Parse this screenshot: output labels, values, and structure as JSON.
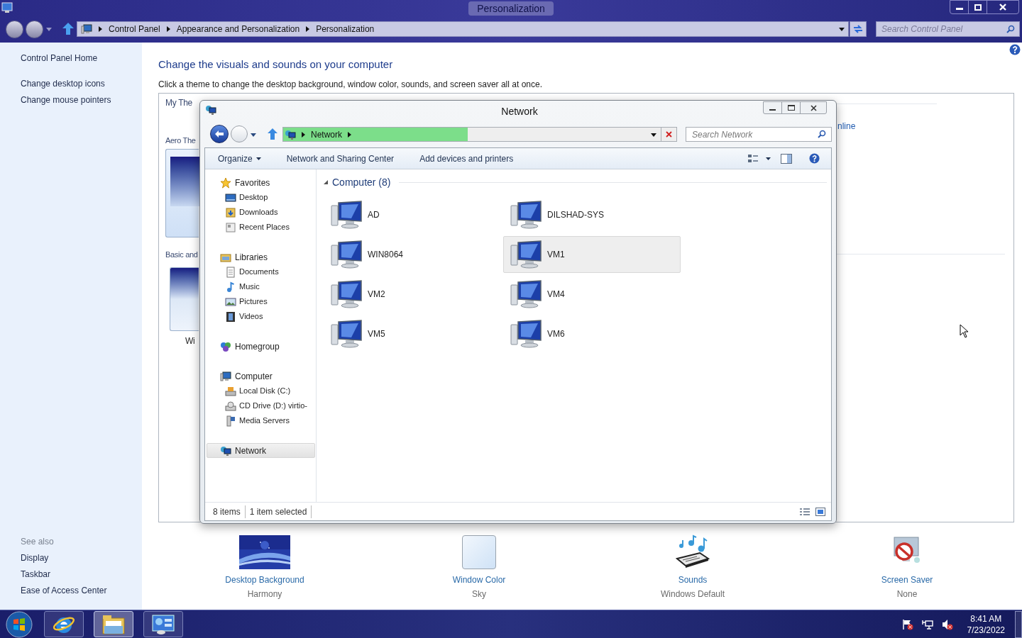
{
  "window": {
    "title": "Personalization",
    "breadcrumbs": [
      "Control Panel",
      "Appearance and Personalization",
      "Personalization"
    ],
    "search_placeholder": "Search Control Panel"
  },
  "sidebar": {
    "links": [
      "Control Panel Home",
      "Change desktop icons",
      "Change mouse pointers"
    ],
    "see_also_heading": "See also",
    "see_also": [
      "Display",
      "Taskbar",
      "Ease of Access Center"
    ]
  },
  "main": {
    "heading": "Change the visuals and sounds on your computer",
    "description": "Click a theme to change the desktop background, window color, sounds, and screen saver all at once.",
    "theme_fragments": [
      "My The",
      "Aero The",
      "Basic and",
      "Wi"
    ],
    "link_fragment": "nline"
  },
  "settings": [
    {
      "kind": "wallpaper",
      "label": "Desktop Background",
      "value": "Harmony"
    },
    {
      "kind": "color",
      "label": "Window Color",
      "value": "Sky"
    },
    {
      "kind": "sounds",
      "label": "Sounds",
      "value": "Windows Default"
    },
    {
      "kind": "screensaver",
      "label": "Screen Saver",
      "value": "None"
    }
  ],
  "network_window": {
    "title": "Network",
    "address": {
      "items": [
        "Network"
      ],
      "level": 0.47
    },
    "search_placeholder": "Search Network",
    "toolbar": [
      "Organize",
      "Network and Sharing Center",
      "Add devices and printers"
    ],
    "nav": [
      {
        "label": "Favorites",
        "kind": "star",
        "selected": false,
        "children": [
          {
            "label": "Desktop",
            "kind": "desktop",
            "selected": false
          },
          {
            "label": "Downloads",
            "kind": "downloads",
            "selected": false
          },
          {
            "label": "Recent Places",
            "kind": "recent",
            "selected": false
          }
        ]
      },
      {
        "label": "Libraries",
        "kind": "library",
        "selected": false,
        "children": [
          {
            "label": "Documents",
            "kind": "document",
            "selected": false
          },
          {
            "label": "Music",
            "kind": "music",
            "selected": false
          },
          {
            "label": "Pictures",
            "kind": "pictures",
            "selected": false
          },
          {
            "label": "Videos",
            "kind": "videos",
            "selected": false
          }
        ]
      },
      {
        "label": "Homegroup",
        "kind": "homegroup",
        "selected": false
      },
      {
        "label": "Computer",
        "kind": "computer",
        "selected": false,
        "children": [
          {
            "label": "Local Disk (C:)",
            "kind": "disk",
            "selected": false
          },
          {
            "label": "CD Drive (D:) virtio-",
            "kind": "cd",
            "selected": false
          },
          {
            "label": "Media Servers",
            "kind": "media",
            "selected": false
          }
        ]
      },
      {
        "label": "Network",
        "kind": "network",
        "selected": true
      }
    ],
    "group": {
      "title": "Computer (8)",
      "expanded": true
    },
    "items": [
      {
        "name": "AD",
        "selected": false
      },
      {
        "name": "DILSHAD-SYS",
        "selected": false
      },
      {
        "name": "WIN8064",
        "selected": false
      },
      {
        "name": "VM1",
        "selected": true
      },
      {
        "name": "VM2",
        "selected": false
      },
      {
        "name": "VM4",
        "selected": false
      },
      {
        "name": "VM5",
        "selected": false
      },
      {
        "name": "VM6",
        "selected": false
      }
    ],
    "status": [
      "8 items",
      "1 item selected"
    ]
  },
  "taskbar": {
    "apps": [
      {
        "kind": "browser",
        "selected": false
      },
      {
        "kind": "folder",
        "selected": true
      },
      {
        "kind": "control-panel",
        "selected": false
      }
    ],
    "time": "8:41 AM",
    "date": "7/23/2022"
  }
}
